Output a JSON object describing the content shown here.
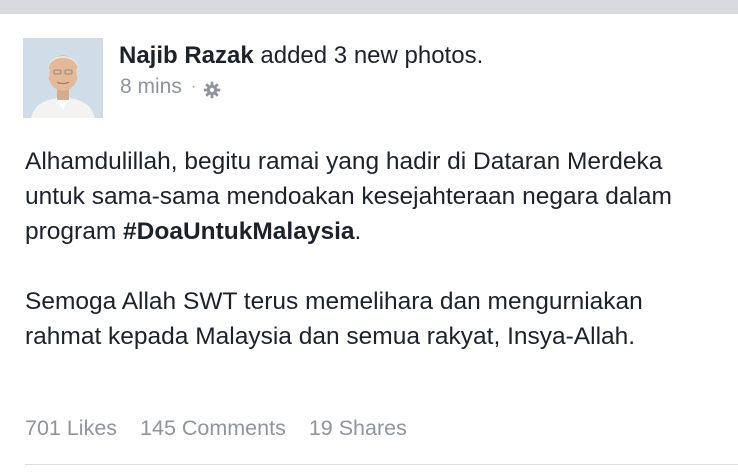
{
  "post": {
    "author": "Najib Razak",
    "action": "added 3 new photos.",
    "time": "8 mins",
    "separator": "·",
    "privacy_icon": "gear-icon",
    "body": {
      "p1_before": "Alhamdulillah, begitu ramai yang hadir di Dataran Merdeka untuk sama-sama mendoakan kesejahteraan negara dalam program ",
      "hashtag": "#DoaUntukMalaysia",
      "p1_after": ".",
      "p2": "Semoga Allah SWT terus memelihara dan mengurniakan rahmat kepada Malaysia dan semua rakyat, Insya-Allah."
    },
    "stats": {
      "likes": "701 Likes",
      "comments": "145 Comments",
      "shares": "19 Shares"
    }
  }
}
